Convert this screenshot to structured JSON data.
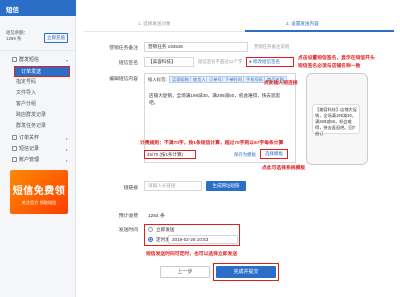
{
  "sidebar": {
    "title": "短信",
    "account_line1": "短信余额：",
    "account_line2": "1299 条",
    "recharge": "立即充值",
    "nav": [
      {
        "label": "群发短信",
        "caret": "▾"
      },
      {
        "label": "订单发送"
      },
      {
        "label": "指定号码"
      },
      {
        "label": "文件导入"
      },
      {
        "label": "客户分组"
      },
      {
        "label": "跨店群发记录"
      },
      {
        "label": "群发任务记录"
      },
      {
        "label": "订单关怀",
        "caret": "▸"
      },
      {
        "label": "短信记录",
        "caret": "▸"
      },
      {
        "label": "账户管理",
        "caret": "▸"
      }
    ],
    "ad_big": "短信免费领",
    "ad_small": "关注官方 领取短信"
  },
  "steps": {
    "s1": "1. 选择发送对象",
    "s2": "2. 设置发送内容"
  },
  "form": {
    "task_label": "营销任务备注",
    "task_value": "营销任务 193536",
    "task_hint": "营销任务备注说明",
    "sign_label": "短信签名",
    "sign_value": "【美容科技】",
    "sign_hint": "短信签名不超过12个字",
    "sign_btn": "● 修改短信签名",
    "content_label": "编辑短信内容",
    "insert_label": "插入标签：",
    "tags": [
      "买家昵称",
      "收货人",
      "订单号",
      "下单时间",
      "手机号码",
      "商品名称"
    ],
    "content_text": "店铺大促销，全场满199减30，满299减50，机会难得，快去逛逛吧。",
    "counter": "45/70 (按1条计算)",
    "save_tpl": "保存为模板",
    "load_tpl": "选择模板",
    "link_label": "短链接",
    "link_placeholder": "请输入长链接",
    "link_btn": "生成网址短链",
    "count_label": "预计收费",
    "count_value": "1254 条",
    "time_label": "发送时间",
    "time_now": "立即发送",
    "time_sched": "定时发送",
    "time_value": "2019-02-26 10:53",
    "prev": "上一步",
    "submit": "完成并提交"
  },
  "phone": {
    "bubble": "【美容科技】店铺大促销，全场满199减30，满299减50，机会难得，快去逛逛吧。回T退订"
  },
  "notes": {
    "n1": "点击设置短信签名，显示在短信开头",
    "n2": "短信签名必须与店铺名称一致",
    "n3": "点此插入短连接",
    "n4": "计费规则：不满70字，按1条短信计算，超过70字则以67字每条计算",
    "n5": "点此可选择系统模板",
    "n6": "短信发送时间可定时，也可以选择立即发送"
  }
}
